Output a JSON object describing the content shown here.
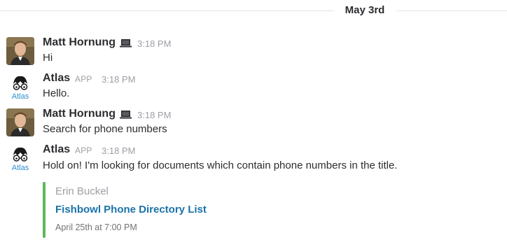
{
  "divider": {
    "date": "May 3rd"
  },
  "messages": [
    {
      "sender": "Matt Hornung",
      "time": "3:18 PM",
      "text": "Hi"
    },
    {
      "sender": "Atlas",
      "badge": "APP",
      "time": "3:18 PM",
      "text": "Hello.",
      "avatar_label": "Atlas"
    },
    {
      "sender": "Matt Hornung",
      "time": "3:18 PM",
      "text": "Search for phone numbers"
    },
    {
      "sender": "Atlas",
      "badge": "APP",
      "time": "3:18 PM",
      "text": "Hold on! I'm looking for documents which contain phone numbers in the title.",
      "avatar_label": "Atlas"
    }
  ],
  "attachment": {
    "author": "Erin Buckel",
    "title": "Fishbowl Phone Directory List",
    "footer": "April 25th at 7:00 PM",
    "accent_color": "#5cb85c"
  },
  "icons": {
    "laptop": "laptop-icon",
    "bot_avatar": "atlas-bot-avatar"
  }
}
